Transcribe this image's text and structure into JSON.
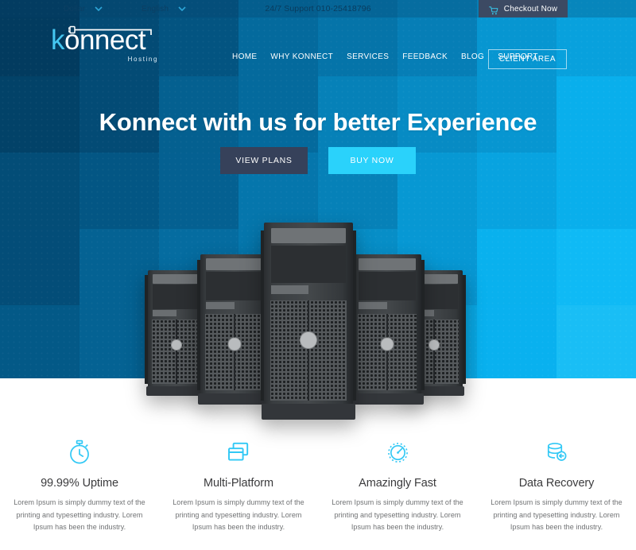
{
  "topbar": {
    "currency": {
      "label": "Dollar",
      "icon": "chevron-down-icon"
    },
    "language": {
      "label": "English",
      "icon": "chevron-down-icon"
    },
    "support": "24/7 Support 010-25418796",
    "checkout": {
      "label": "Checkout Now",
      "icon": "cart-icon"
    }
  },
  "header": {
    "logo": {
      "k": "k",
      "rest": "onnect",
      "sub": "Hosting",
      "icon": "plug-cable-icon"
    },
    "nav": [
      {
        "label": "HOME"
      },
      {
        "label": "WHY KONNECT"
      },
      {
        "label": "SERVICES"
      },
      {
        "label": "FEEDBACK"
      },
      {
        "label": "BLOG"
      },
      {
        "label": "SUPPORT"
      }
    ],
    "client_area": "CLIENT AREA"
  },
  "hero": {
    "title": "Konnect with us for better Experience",
    "primary_button": "VIEW PLANS",
    "secondary_button": "BUY NOW",
    "image_alt": "server-towers"
  },
  "features": [
    {
      "icon": "stopwatch-icon",
      "title": "99.99% Uptime",
      "text": "Lorem Ipsum is simply dummy text of the printing and typesetting industry. Lorem Ipsum has been the industry."
    },
    {
      "icon": "windows-layers-icon",
      "title": "Multi-Platform",
      "text": "Lorem Ipsum is simply dummy text of the printing and typesetting industry. Lorem Ipsum has been the industry."
    },
    {
      "icon": "speedometer-icon",
      "title": "Amazingly Fast",
      "text": "Lorem Ipsum is simply dummy text of the printing and typesetting industry. Lorem Ipsum has been the industry."
    },
    {
      "icon": "database-restore-icon",
      "title": "Data Recovery",
      "text": "Lorem Ipsum is simply dummy text of the printing and typesetting industry. Lorem Ipsum has been the industry."
    }
  ],
  "colors": {
    "hero_dark": "#013a5e",
    "hero_light": "#18bdf7",
    "accent_cyan": "#2ad2fb",
    "dark_navy": "#36415a",
    "icon_cyan": "#31c8f5",
    "logo_k": "#45c6f0",
    "text_body": "#6f7173",
    "text_heading": "#3b3b3d"
  }
}
